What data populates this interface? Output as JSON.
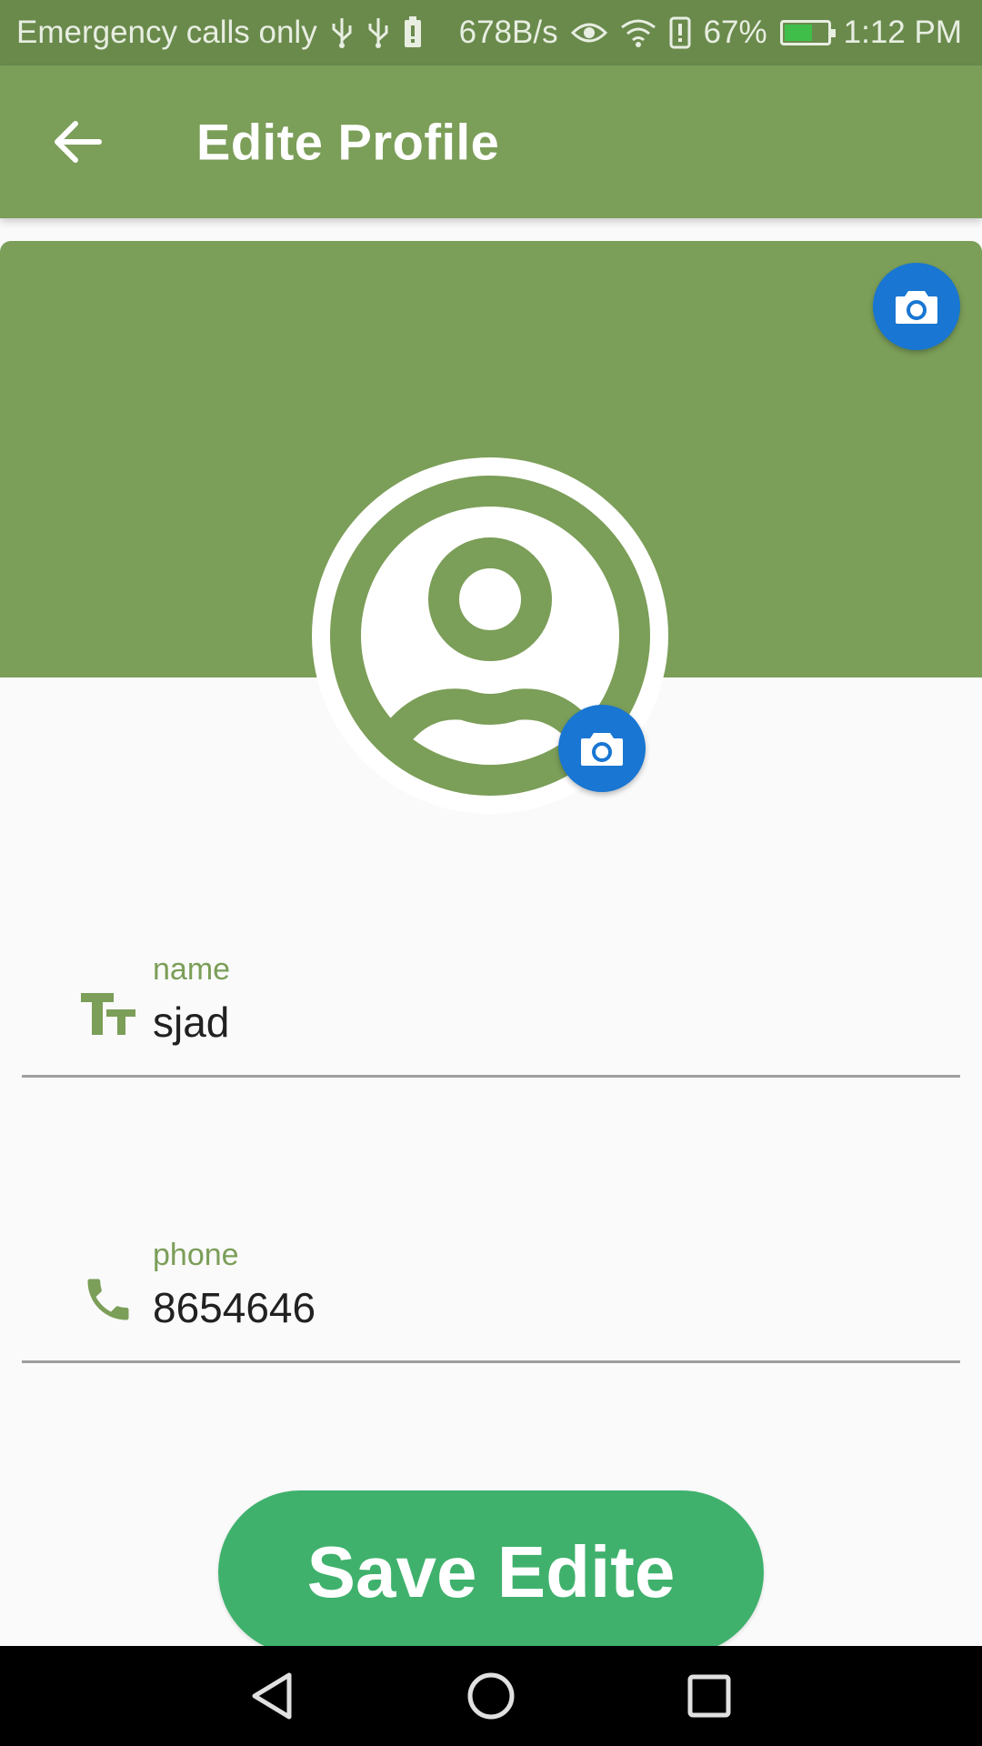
{
  "status_bar": {
    "carrier_text": "Emergency calls only",
    "net_speed": "678B/s",
    "battery_percent": "67%",
    "battery_level": 0.67,
    "time": "1:12 PM"
  },
  "app_bar": {
    "title": "Edite Profile",
    "back_icon": "arrow-back-icon"
  },
  "profile": {
    "cover_camera_icon": "camera-icon",
    "avatar_icon": "account-circle-icon",
    "avatar_camera_icon": "camera-icon"
  },
  "form": {
    "name": {
      "label": "name",
      "value": "sjad",
      "icon": "text-fields-icon"
    },
    "phone": {
      "label": "phone",
      "value": "8654646",
      "icon": "phone-icon"
    }
  },
  "save_button": {
    "label": "Save Edite"
  },
  "colors": {
    "primary": "#7b9e58",
    "fab": "#1976d2",
    "save": "#3fb16c"
  }
}
